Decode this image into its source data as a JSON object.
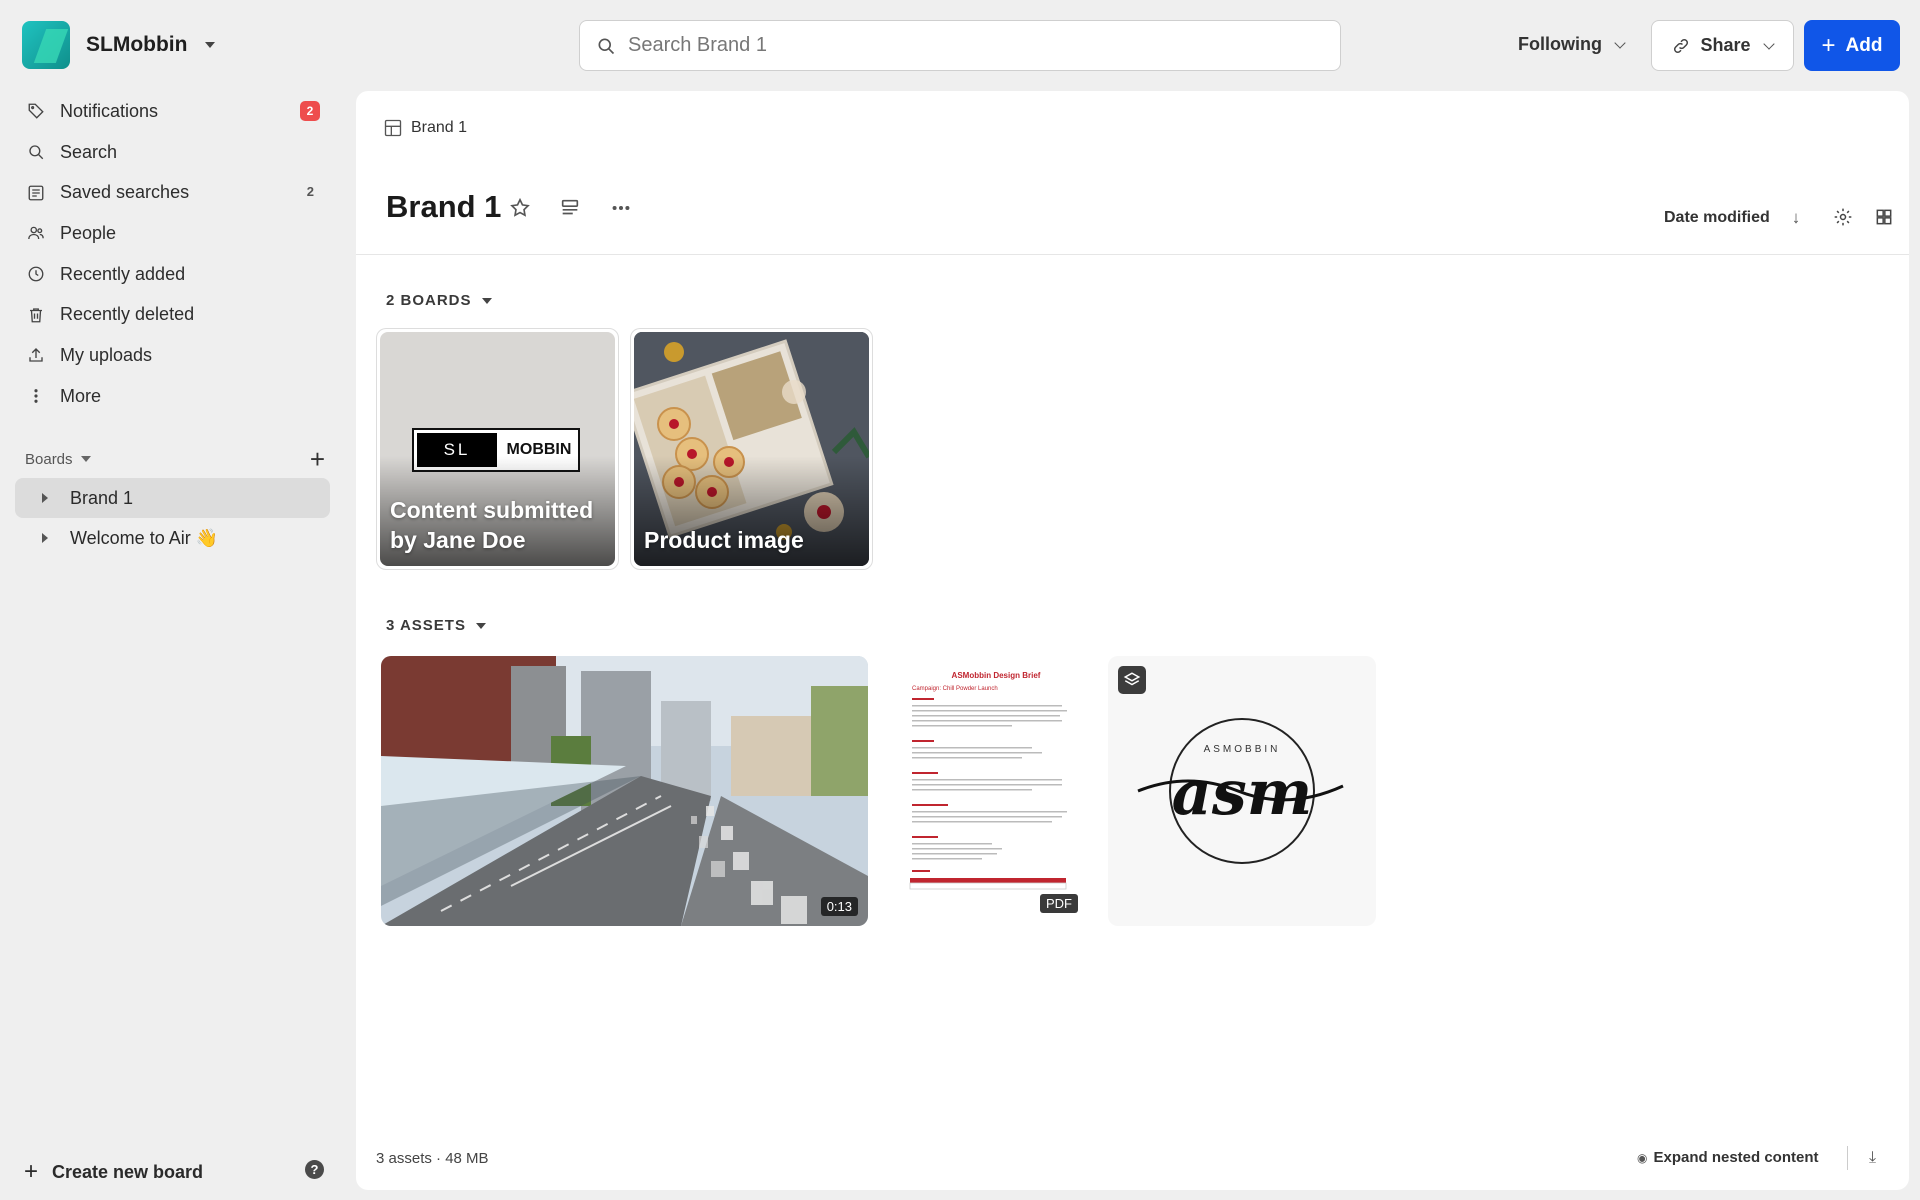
{
  "workspace": {
    "name": "SLMobbin"
  },
  "sidebar": {
    "nav": [
      {
        "label": "Notifications",
        "icon": "tag-icon",
        "badge": "2"
      },
      {
        "label": "Search",
        "icon": "search-icon"
      },
      {
        "label": "Saved searches",
        "icon": "saved-search-icon",
        "count": "2"
      },
      {
        "label": "People",
        "icon": "people-icon"
      },
      {
        "label": "Recently added",
        "icon": "clock-icon"
      },
      {
        "label": "Recently deleted",
        "icon": "trash-icon"
      },
      {
        "label": "My uploads",
        "icon": "upload-icon"
      },
      {
        "label": "More",
        "icon": "more-vertical-icon"
      }
    ],
    "boards_header": "Boards",
    "boards": [
      {
        "label": "Brand 1"
      },
      {
        "label": "Welcome to Air 👋"
      }
    ],
    "create_board": "Create new board",
    "help": "?"
  },
  "topbar": {
    "search_placeholder": "Search Brand 1",
    "following": "Following",
    "share": "Share",
    "add": "Add",
    "accent": "#1056e8"
  },
  "main": {
    "breadcrumb": "Brand 1",
    "title": "Brand 1",
    "sort_label": "Date modified",
    "boards_section": "2 BOARDS",
    "board_cards": [
      {
        "label": "Content submitted by Jane Doe",
        "logo_left": "SL",
        "logo_right": "MOBBIN"
      },
      {
        "label": "Product image"
      }
    ],
    "assets_section": "3 ASSETS",
    "assets": [
      {
        "type": "video",
        "duration": "0:13"
      },
      {
        "type": "pdf",
        "tag": "PDF",
        "doc_title": "ASMobbin Design Brief",
        "doc_subtitle": "Campaign: Chill Powder Launch"
      },
      {
        "type": "image",
        "logo_text": "asm",
        "logo_ring": "ASMOBBIN"
      }
    ],
    "footer_summary": "3 assets · 48 MB",
    "expand_nested": "Expand nested content"
  }
}
